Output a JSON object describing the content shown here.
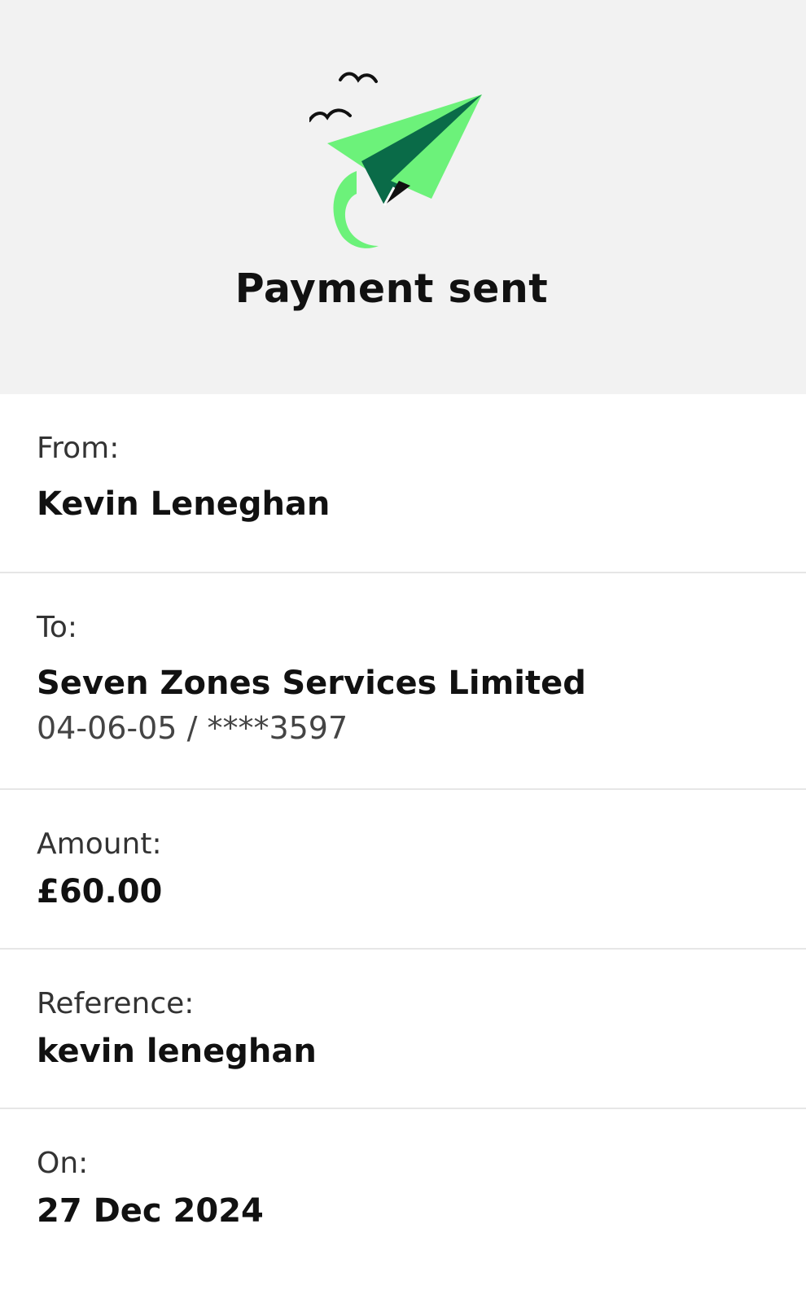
{
  "header": {
    "title": "Payment sent",
    "icon": "paper-plane-icon",
    "colors": {
      "plane_light": "#6cf27a",
      "plane_dark": "#0a6b48",
      "background": "#f2f2f2"
    }
  },
  "details": {
    "from": {
      "label": "From:",
      "value": "Kevin Leneghan"
    },
    "to": {
      "label": "To:",
      "value": "Seven Zones Services Limited",
      "account": "04-06-05 / ****3597"
    },
    "amount": {
      "label": "Amount:",
      "value": "£60.00"
    },
    "reference": {
      "label": "Reference:",
      "value": "kevin leneghan"
    },
    "on": {
      "label": "On:",
      "value": "27 Dec 2024"
    }
  }
}
